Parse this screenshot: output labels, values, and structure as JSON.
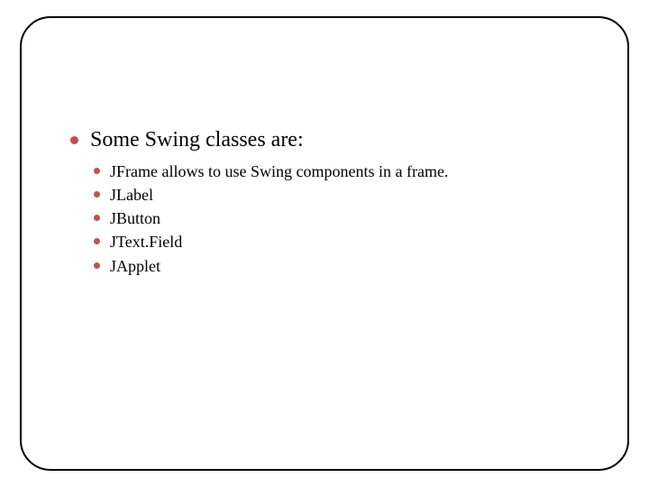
{
  "main": {
    "heading": "Some Swing classes are:",
    "items": [
      "JFrame allows to use Swing components in a frame.",
      "JLabel",
      "JButton",
      "JText.Field",
      "JApplet"
    ]
  }
}
